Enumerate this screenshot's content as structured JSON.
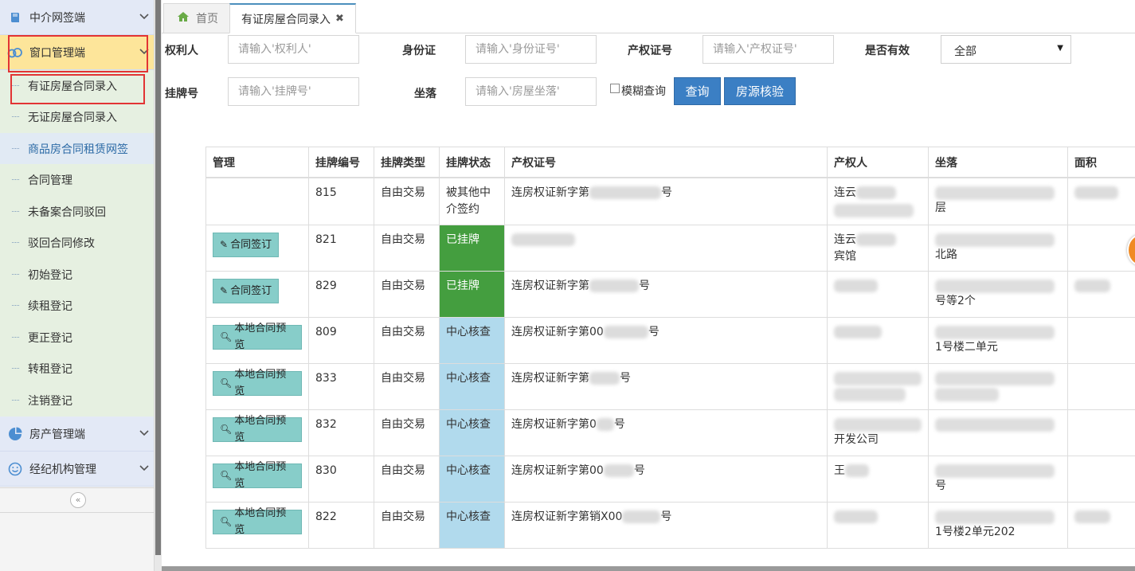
{
  "sidebar": {
    "sections": [
      {
        "label": "中介网签端",
        "icon": "book-icon"
      },
      {
        "label": "窗口管理端",
        "icon": "cloud-link-icon"
      },
      {
        "label": "房产管理端",
        "icon": "pie-chart-icon"
      },
      {
        "label": "经纪机构管理",
        "icon": "smile-icon"
      }
    ],
    "sub_items": [
      "有证房屋合同录入",
      "无证房屋合同录入",
      "商品房合同租赁网签",
      "合同管理",
      "未备案合同驳回",
      "驳回合同修改",
      "初始登记",
      "续租登记",
      "更正登记",
      "转租登记",
      "注销登记"
    ],
    "collapse_icon": "«"
  },
  "tabs": {
    "home_label": "首页",
    "active_label": "有证房屋合同录入",
    "close_glyph": "✖"
  },
  "filters": {
    "owner_label": "权利人",
    "owner_placeholder": "请输入'权利人'",
    "idcard_label": "身份证",
    "idcard_placeholder": "请输入'身份证号'",
    "cert_label": "产权证号",
    "cert_placeholder": "请输入'产权证号'",
    "valid_label": "是否有效",
    "valid_value": "全部",
    "listing_label": "挂牌号",
    "listing_placeholder": "请输入'挂牌号'",
    "location_label": "坐落",
    "location_placeholder": "请输入'房屋坐落'",
    "fuzzy_label": "模糊查询",
    "query_button": "查询",
    "verify_button": "房源核验"
  },
  "table": {
    "headers": [
      "管理",
      "挂牌编号",
      "挂牌类型",
      "挂牌状态",
      "产权证号",
      "产权人",
      "坐落",
      "面积"
    ],
    "rows": [
      {
        "action": "",
        "no": "815",
        "type": "自由交易",
        "status": "被其他中介签约",
        "status_kind": "plain",
        "cert": "连房权证新字第",
        "cert_tail": "号",
        "owner": "连云",
        "loc": "层",
        "area": ""
      },
      {
        "action": "合同签订",
        "action_icon": "pencil-icon",
        "no": "821",
        "type": "自由交易",
        "status": "已挂牌",
        "status_kind": "green",
        "cert": "",
        "cert_tail": "",
        "owner": "连云",
        "owner2": "宾馆",
        "loc": "北路",
        "area": ""
      },
      {
        "action": "合同签订",
        "action_icon": "pencil-icon",
        "no": "829",
        "type": "自由交易",
        "status": "已挂牌",
        "status_kind": "green",
        "cert": "连房权证新字第",
        "cert_tail": "号",
        "owner": "",
        "loc": "号等2个",
        "area": ""
      },
      {
        "action": "本地合同预览",
        "action_icon": "search-icon",
        "no": "809",
        "type": "自由交易",
        "status": "中心核查",
        "status_kind": "blue",
        "cert": "连房权证新字第00",
        "cert_tail": "号",
        "owner": "",
        "loc": "1号楼二单元",
        "area": ""
      },
      {
        "action": "本地合同预览",
        "action_icon": "search-icon",
        "no": "833",
        "type": "自由交易",
        "status": "中心核查",
        "status_kind": "blue",
        "cert": "连房权证新字第",
        "cert_tail": "号",
        "owner": "",
        "loc": "",
        "area": ""
      },
      {
        "action": "本地合同预览",
        "action_icon": "search-icon",
        "no": "832",
        "type": "自由交易",
        "status": "中心核查",
        "status_kind": "blue",
        "cert": "连房权证新字第0",
        "cert_tail": "号",
        "owner": "开发公司",
        "loc": "",
        "area": ""
      },
      {
        "action": "本地合同预览",
        "action_icon": "search-icon",
        "no": "830",
        "type": "自由交易",
        "status": "中心核查",
        "status_kind": "blue",
        "cert": "连房权证新字第00",
        "cert_tail": "号",
        "owner": "王",
        "loc": "号",
        "area": ""
      },
      {
        "action": "本地合同预览",
        "action_icon": "search-icon",
        "no": "822",
        "type": "自由交易",
        "status": "中心核查",
        "status_kind": "blue",
        "cert": "连房权证新字第销X00",
        "cert_tail": "号",
        "owner": "",
        "loc": "1号楼2单元202",
        "area": ""
      }
    ]
  },
  "colors": {
    "accent_blue": "#3b7fc4",
    "status_green": "#449e3f",
    "status_blue": "#b1daed",
    "highlight_red": "#e23434",
    "active_menu": "#fde59a"
  }
}
